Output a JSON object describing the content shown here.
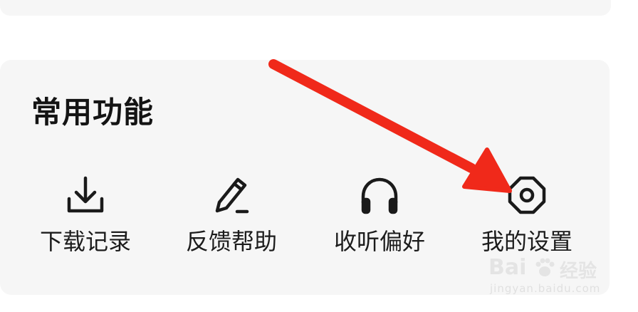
{
  "section": {
    "title": "常用功能"
  },
  "functions": [
    {
      "label": "下载记录",
      "icon": "download-icon"
    },
    {
      "label": "反馈帮助",
      "icon": "pencil-icon"
    },
    {
      "label": "收听偏好",
      "icon": "headphones-icon"
    },
    {
      "label": "我的设置",
      "icon": "settings-icon"
    }
  ],
  "annotation": {
    "arrow_color": "#f0291a"
  },
  "watermark": {
    "brand": "Bai",
    "suffix": "经验",
    "url": "jingyan.baidu.com"
  },
  "colors": {
    "card_background": "#f6f6f6",
    "text_primary": "#141414",
    "icon_stroke": "#1a1a1a"
  }
}
